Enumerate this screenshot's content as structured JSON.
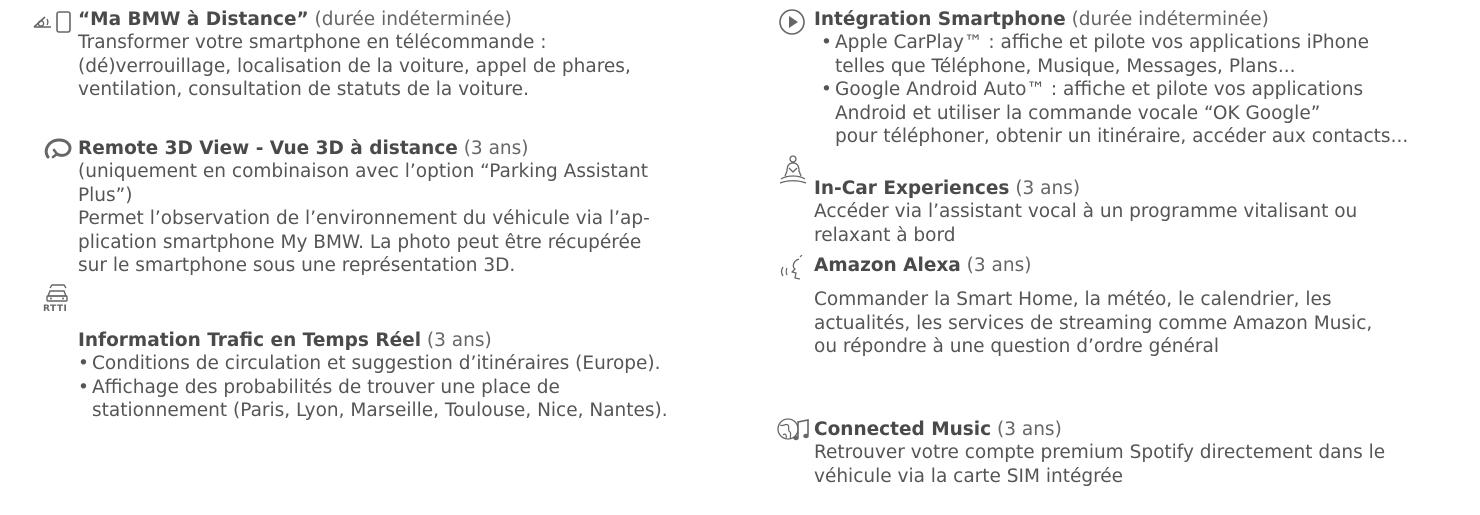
{
  "left": {
    "ma_bmw": {
      "title": "“Ma BMW à Distance”",
      "duration": " (durée indéterminée)",
      "lines": [
        "Transformer votre smartphone en télécommande :",
        "(dé)verrouillage, localisation de la voiture, appel de phares,",
        "ventilation, consultation de statuts de la voiture."
      ]
    },
    "remote3d": {
      "title": "Remote 3D View - Vue 3D à distance",
      "duration": " (3 ans)",
      "lines": [
        "(uniquement en combinaison avec l’option “Parking Assistant",
        "Plus”)",
        "Permet l’observation de l’environnement du véhicule via l’ap-",
        "plication smartphone My BMW. La photo peut être récupérée",
        "sur le smartphone sous une représentation 3D."
      ]
    },
    "rtti": {
      "icon_label": "RTTI",
      "title": "Information Trafic en Temps Réel",
      "duration": " (3 ans)",
      "bullet1": "Conditions de circulation et suggestion d’itinéraires (Europe).",
      "bullet2": "Affichage des probabilités de trouver une place de",
      "bullet2_cont": "stationnement (Paris, Lyon, Marseille, Toulouse, Nice, Nantes)."
    }
  },
  "right": {
    "smartphone": {
      "title": "Intégration Smartphone",
      "duration": " (durée indéterminée)",
      "bullet1": "Apple CarPlay™ : affiche et pilote vos applications iPhone",
      "bullet1_cont": "telles que Téléphone, Musique, Messages, Plans...",
      "bullet2": "Google Android Auto™ : affiche et pilote vos applications",
      "bullet2_cont1": "Android et utiliser la commande vocale “OK Google”",
      "bullet2_cont2": "pour téléphoner, obtenir un itinéraire, accéder aux contacts..."
    },
    "incar": {
      "title": "In-Car Experiences",
      "duration": " (3 ans)",
      "lines": [
        "Accéder via l’assistant vocal à un programme vitalisant ou",
        "relaxant à bord"
      ]
    },
    "alexa": {
      "title": "Amazon Alexa",
      "duration": " (3 ans)",
      "lines": [
        "Commander la Smart Home, la météo, le calendrier, les",
        "actualités, les services de streaming comme Amazon Music,",
        "ou répondre à une question d’ordre général"
      ]
    },
    "music": {
      "title": "Connected Music",
      "duration": " (3 ans)",
      "lines": [
        "Retrouver votre compte premium Spotify directement dans le",
        "véhicule via la carte SIM intégrée"
      ]
    }
  },
  "bullet_char": "•",
  "icons": [
    "remote-phone-icon",
    "rotate-3d-icon",
    "car-traffic-icon",
    "play-circle-icon",
    "meditation-icon",
    "voice-icon",
    "globe-music-icon"
  ]
}
